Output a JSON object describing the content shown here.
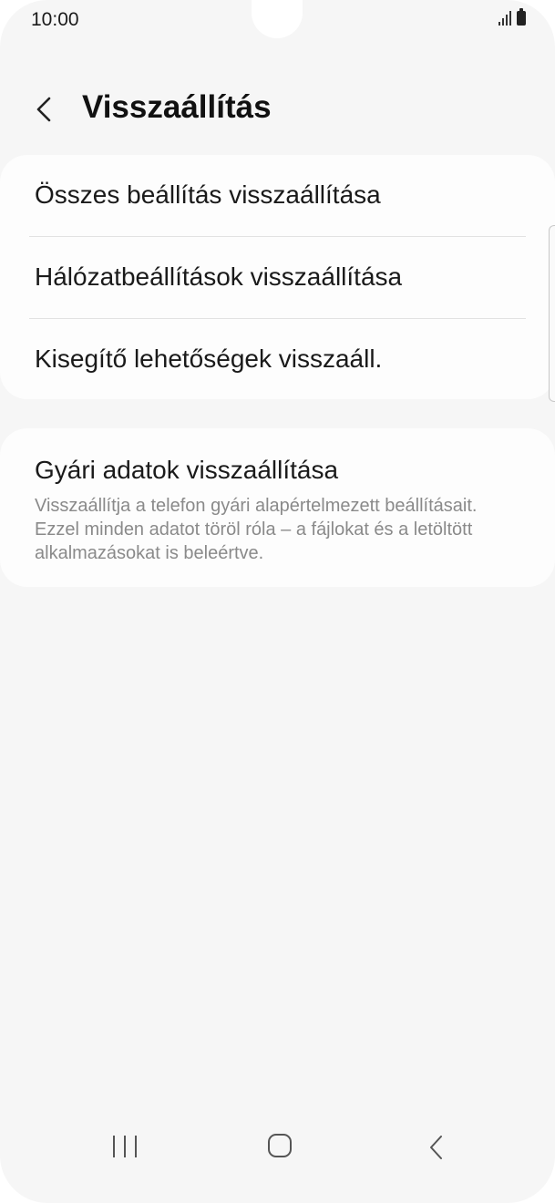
{
  "status_bar": {
    "time": "10:00",
    "icons": [
      "signal-icon",
      "battery-icon"
    ]
  },
  "header": {
    "title": "Visszaállítás",
    "back_icon": "chevron-left-icon"
  },
  "reset_options": {
    "items": [
      {
        "label": "Összes beállítás visszaállítása"
      },
      {
        "label": "Hálózatbeállítások visszaállítása"
      },
      {
        "label": "Kisegítő lehetőségek visszaáll."
      }
    ]
  },
  "factory_reset": {
    "title": "Gyári adatok visszaállítása",
    "description": "Visszaállítja a telefon gyári alapértelmezett beállításait. Ezzel minden adatot töröl róla – a fájlokat és a letöltött alkalmazásokat is beleértve."
  },
  "nav_bar": {
    "icons": [
      "recent-apps-icon",
      "home-icon",
      "back-icon"
    ]
  },
  "colors": {
    "background": "#f6f6f6",
    "card": "#fdfdfd",
    "text": "#1a1a1a",
    "secondary_text": "#8a8a8a"
  }
}
